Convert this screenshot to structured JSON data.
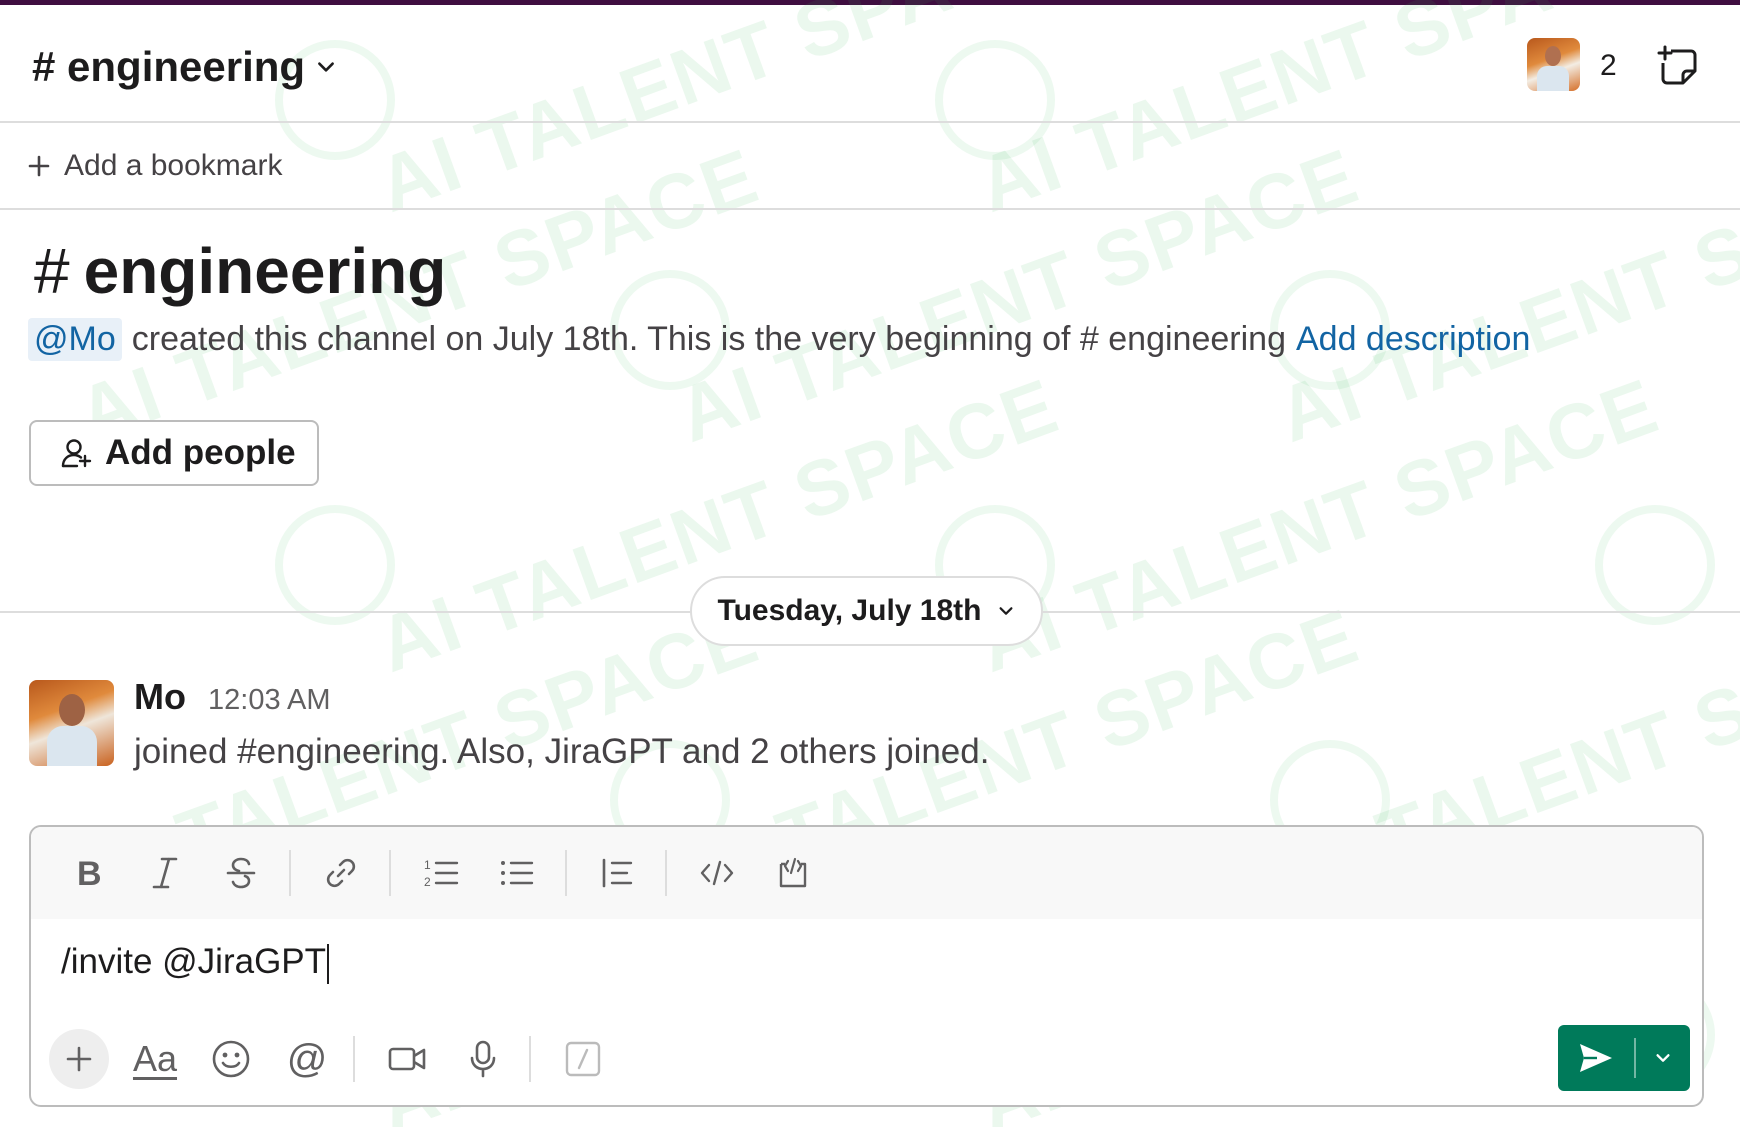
{
  "header": {
    "channel_title": "# engineering",
    "member_count": "2",
    "icons": [
      "chevron-down-icon",
      "canvas-add-icon"
    ]
  },
  "bookmarks": {
    "add_label": "Add a bookmark"
  },
  "intro": {
    "title_hash": "#",
    "title_name": "engineering",
    "mention": "@Mo",
    "desc_text": "created this channel on July 18th. This is the very beginning of # engineering",
    "add_description": "Add description",
    "add_people": "Add people"
  },
  "divider": {
    "date": "Tuesday, July 18th"
  },
  "message": {
    "author": "Mo",
    "time": "12:03 AM",
    "text": "joined #engineering. Also, JiraGPT and 2 others joined."
  },
  "composer": {
    "input_value": "/invite @JiraGPT",
    "format_buttons": [
      "bold",
      "italic",
      "strikethrough",
      "link",
      "ordered-list",
      "bulleted-list",
      "blockquote",
      "code",
      "code-block"
    ],
    "action_buttons": [
      "plus",
      "formatting",
      "emoji",
      "mention",
      "video",
      "audio",
      "shortcuts"
    ],
    "format_toggle_label": "Aa",
    "mention_label": "@"
  },
  "colors": {
    "aubergine": "#3f0e40",
    "link_blue": "#1264a3",
    "send_green": "#007a5a",
    "watermark_green": "#3cbe5a"
  },
  "watermark_text": "AI TALENT SPACE"
}
